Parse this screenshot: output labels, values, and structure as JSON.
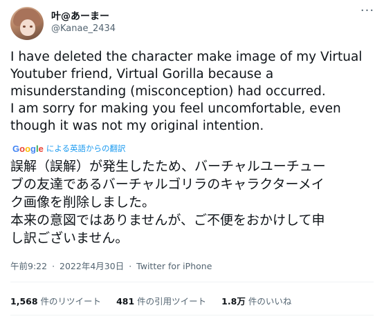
{
  "author": {
    "display_name": "叶@あーまー",
    "handle": "@Kanae_2434",
    "avatar_icon": "avatar-icon"
  },
  "menu": {
    "more_icon": "more-icon",
    "label": "···"
  },
  "tweet": {
    "translated_text": "I have deleted the character make image of my Virtual\nYoutuber friend, Virtual Gorilla because a\nmisunderstanding (misconception) had occurred.\nI am sorry for making you feel uncomfortable, even\nthough it was not my original intention.",
    "translation": {
      "provider_logo": "Google",
      "label": "による英語からの翻訳"
    },
    "original_text": "誤解（誤解）が発生したため、バーチャルユーチュー\nブの友達であるバーチャルゴリラのキャラクターメイ\nク画像を削除しました。\n本来の意図ではありませんが、ご不便をおかけして申\nし訳ございません。",
    "time": "午前9:22",
    "date": "2022年4月30日",
    "source": "Twitter for iPhone"
  },
  "stats": [
    {
      "count": "1,568",
      "label": "件のリツイート"
    },
    {
      "count": "481",
      "label": "件の引用ツイート"
    },
    {
      "count": "1.8万",
      "label": "件のいいね"
    }
  ]
}
